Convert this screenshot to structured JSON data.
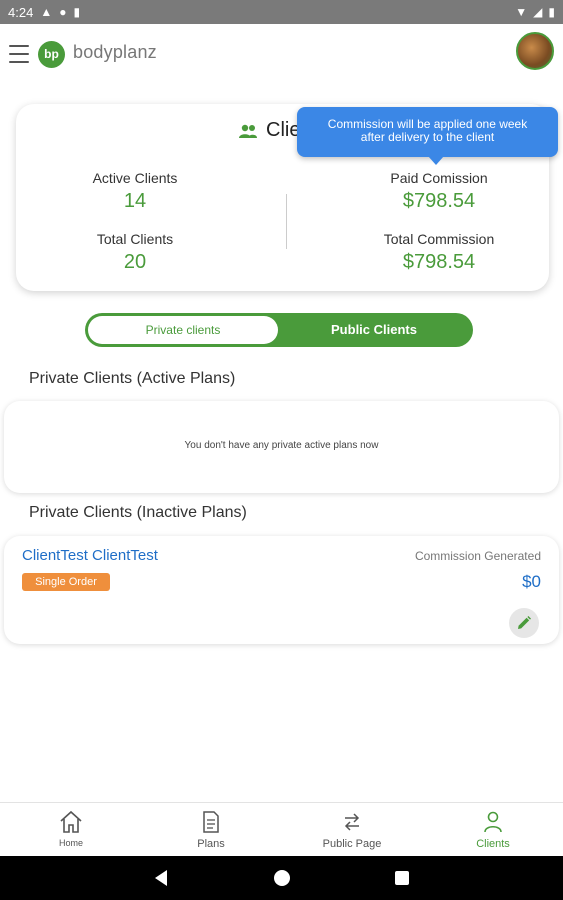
{
  "status": {
    "time": "4:24"
  },
  "app": {
    "brand": "bodyplanz",
    "logo_mark": "bp"
  },
  "summary": {
    "title": "Clie",
    "active_clients_label": "Active Clients",
    "active_clients_value": "14",
    "total_clients_label": "Total Clients",
    "total_clients_value": "20",
    "paid_commission_label": "Paid Comission",
    "paid_commission_value": "$798.54",
    "total_commission_label": "Total Commission",
    "total_commission_value": "$798.54"
  },
  "tooltip": {
    "line1": "Commission will be applied one week",
    "line2": "after delivery to the client"
  },
  "toggle": {
    "private_label": "Private clients",
    "public_label": "Public Clients"
  },
  "sections": {
    "active_title": "Private Clients (Active Plans)",
    "active_empty": "You don't have any private active plans now",
    "inactive_title": "Private Clients (Inactive Plans)"
  },
  "client": {
    "name": "ClientTest ClientTest",
    "badge": "Single Order",
    "commission_label": "Commission Generated",
    "commission_value": "$0"
  },
  "bottom_nav": [
    {
      "label": "Home",
      "icon": "home-icon"
    },
    {
      "label": "Plans",
      "icon": "document-icon"
    },
    {
      "label": "Public Page",
      "icon": "swap-arrows-icon"
    },
    {
      "label": "Clients",
      "icon": "person-icon"
    }
  ],
  "colors": {
    "brand_green": "#4a9b3b",
    "link_blue": "#1f6ec7",
    "tooltip_blue": "#3b87e6",
    "badge_orange": "#ef8f3c"
  }
}
